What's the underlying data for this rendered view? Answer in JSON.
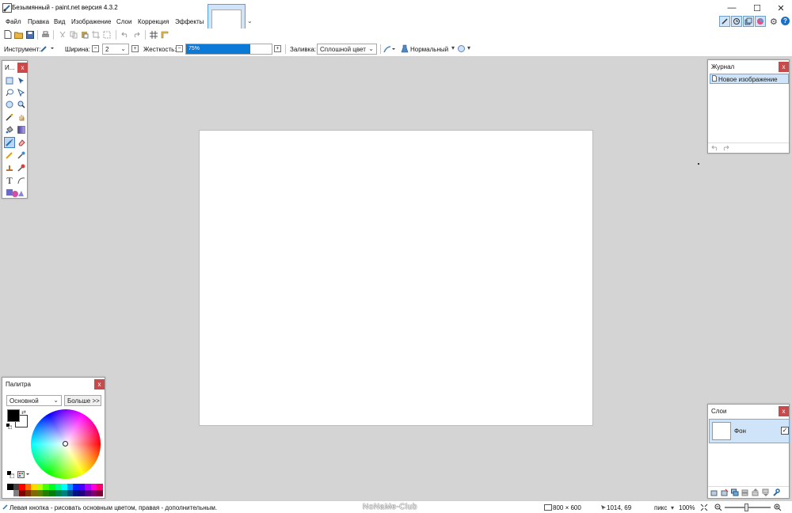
{
  "window": {
    "title": "Безымянный - paint.net версия 4.3.2",
    "minimize": "—",
    "maximize": "☐",
    "close": "✕"
  },
  "menu": [
    "Файл",
    "Правка",
    "Вид",
    "Изображение",
    "Слои",
    "Коррекция",
    "Эффекты"
  ],
  "toolbar2": {
    "tool_label": "Инструмент:",
    "width_label": "Ширина:",
    "width_value": "2",
    "hardness_label": "Жесткость:",
    "hardness_value": "75%",
    "hardness_fraction": 0.75,
    "fill_label": "Заливка:",
    "fill_value": "Сплошной цвет",
    "blend_value": "Нормальный"
  },
  "tools_panel": {
    "title": "И...",
    "close": "x",
    "text_tool_glyph": "T"
  },
  "history_panel": {
    "title": "Журнал",
    "close": "x",
    "item": "Новое изображение"
  },
  "palette_panel": {
    "title": "Палитра",
    "close": "x",
    "mode": "Основной",
    "more_button": "Больше >>",
    "colors": {
      "primary": "#000000",
      "secondary": "#ffffff"
    }
  },
  "layers_panel": {
    "title": "Слои",
    "close": "x",
    "layer_name": "Фон",
    "visible": true
  },
  "status": {
    "hint": "Левая кнопка - рисовать основным цветом, правая - дополнительным.",
    "watermark": "NoNaMe-Club",
    "image_size": "800 × 600",
    "cursor_pos": "1014, 69",
    "units": "пикс",
    "zoom": "100%"
  },
  "colors": {
    "accent": "#0a7ad6",
    "close_red": "#c84a4a",
    "selection": "#cfe4f8",
    "workspace": "#d4d4d4"
  }
}
